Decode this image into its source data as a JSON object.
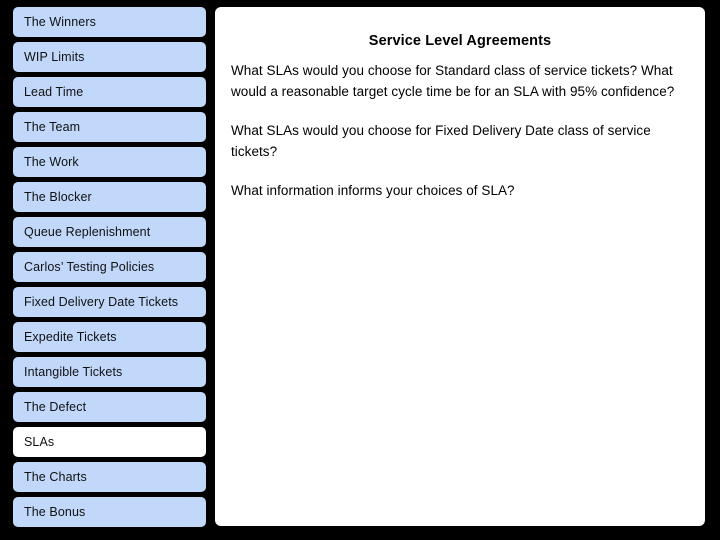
{
  "slide": {
    "background_color": "#000000",
    "panel_color": "#ffffff",
    "nav_item_color": "#c1d8fb",
    "nav_item_active_color": "#ffffff"
  },
  "sidebar": {
    "items": [
      {
        "label": "The Winners",
        "active": false
      },
      {
        "label": "WIP Limits",
        "active": false
      },
      {
        "label": "Lead Time",
        "active": false
      },
      {
        "label": "The Team",
        "active": false
      },
      {
        "label": "The Work",
        "active": false
      },
      {
        "label": "The Blocker",
        "active": false
      },
      {
        "label": "Queue Replenishment",
        "active": false
      },
      {
        "label": "Carlos’ Testing Policies",
        "active": false
      },
      {
        "label": "Fixed Delivery Date Tickets",
        "active": false
      },
      {
        "label": "Expedite Tickets",
        "active": false
      },
      {
        "label": "Intangible Tickets",
        "active": false
      },
      {
        "label": "The Defect",
        "active": false
      },
      {
        "label": "SLAs",
        "active": true
      },
      {
        "label": "The Charts",
        "active": false
      },
      {
        "label": "The Bonus",
        "active": false
      }
    ]
  },
  "content": {
    "title": "Service Level Agreements",
    "paragraphs": [
      "What SLAs would you choose for Standard class of service tickets? What would a reasonable target cycle time be for an SLA with 95% confidence?",
      "What SLAs would you choose for Fixed Delivery Date class of service tickets?",
      "What information informs your choices of SLA?"
    ]
  }
}
